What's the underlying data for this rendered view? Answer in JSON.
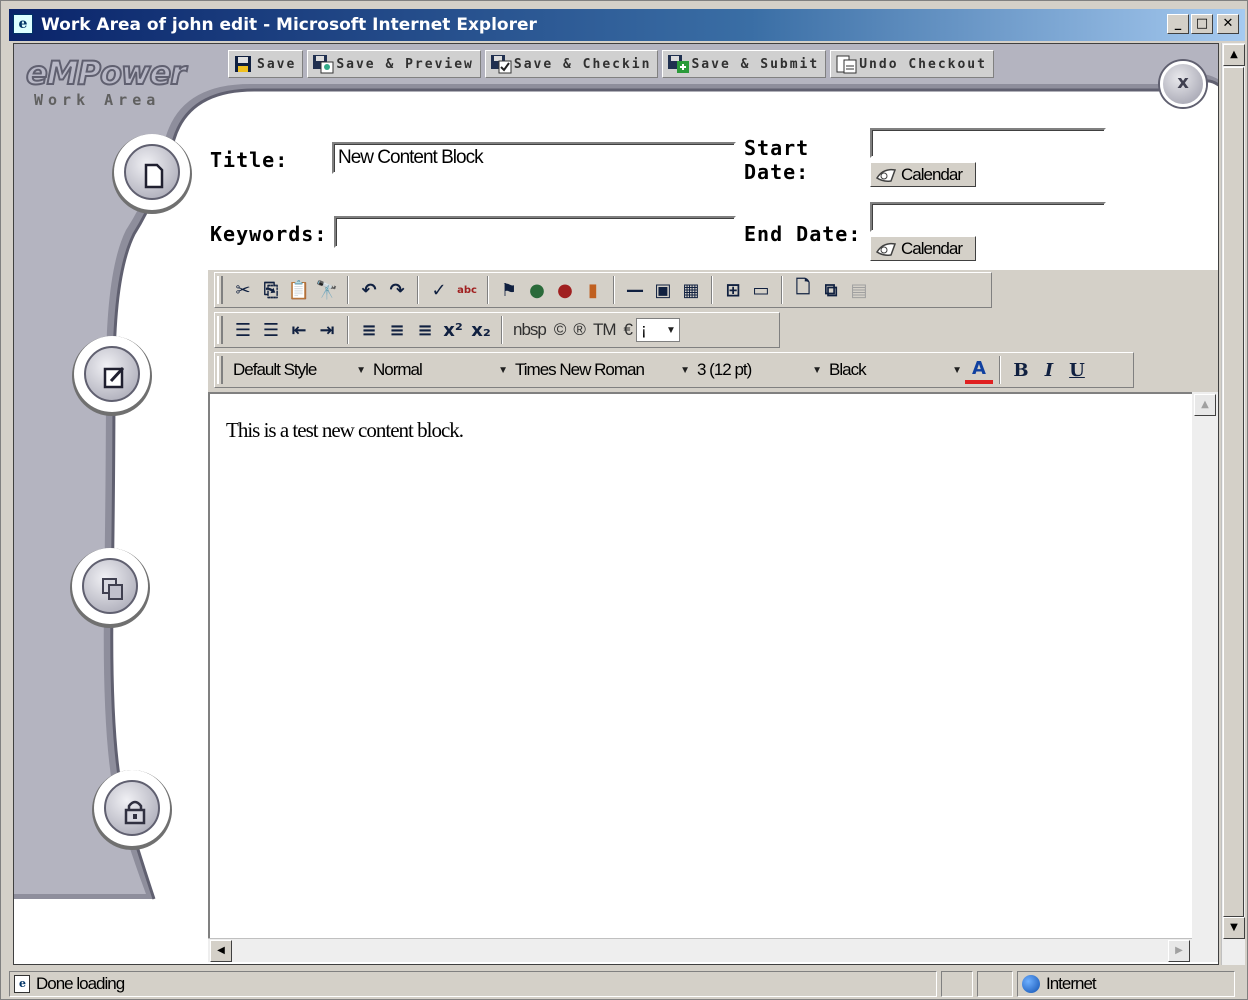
{
  "window": {
    "title": "Work Area of john edit - Microsoft Internet Explorer"
  },
  "brand": {
    "logo": "eMPower",
    "subtitle": "Work Area"
  },
  "toolbar": {
    "save": "Save",
    "save_preview": "Save & Preview",
    "save_checkin": "Save & Checkin",
    "save_submit": "Save & Submit",
    "undo_checkout": "Undo Checkout",
    "close": "x"
  },
  "form": {
    "title_label": "Title:",
    "title_value": "New Content Block",
    "keywords_label": "Keywords:",
    "keywords_value": "",
    "start_date_label_1": "Start",
    "start_date_label_2": "Date:",
    "end_date_label": "End Date:",
    "calendar_label": "Calendar"
  },
  "editor": {
    "nbsp": "nbsp",
    "trademark": "TM",
    "euro": "€",
    "style": "Default Style",
    "format": "Normal",
    "font": "Times New Roman",
    "size": "3 (12 pt)",
    "color": "Black",
    "bold": "B",
    "italic": "I",
    "underline": "U",
    "content": "This is a test new content block."
  },
  "status": {
    "text": "Done loading",
    "zone": "Internet"
  },
  "colors": {
    "titlebar": "#0a246a",
    "chrome": "#d4d0c8",
    "sidebar": "#8e8e9c"
  }
}
